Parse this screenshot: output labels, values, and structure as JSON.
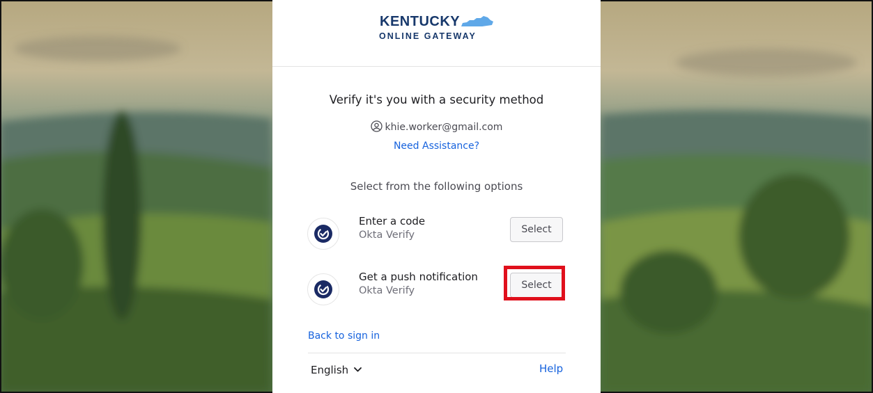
{
  "logo": {
    "line1": "KENTUCKY",
    "line2": "ONLINE GATEWAY"
  },
  "verify": {
    "title": "Verify it's you with a security method",
    "email": "khie.worker@gmail.com",
    "need_assistance": "Need Assistance?",
    "subtitle": "Select from the following options"
  },
  "options": [
    {
      "name": "Enter a code",
      "provider": "Okta Verify",
      "button": "Select",
      "icon": "okta-verify-icon"
    },
    {
      "name": "Get a push notification",
      "provider": "Okta Verify",
      "button": "Select",
      "icon": "okta-verify-icon",
      "highlighted": true
    }
  ],
  "footer": {
    "back": "Back to sign in",
    "language": "English",
    "help": "Help"
  },
  "colors": {
    "brand_navy": "#17386b",
    "link_blue": "#1662dd",
    "highlight_red": "#e0101c",
    "icon_navy": "#1a2a64"
  }
}
